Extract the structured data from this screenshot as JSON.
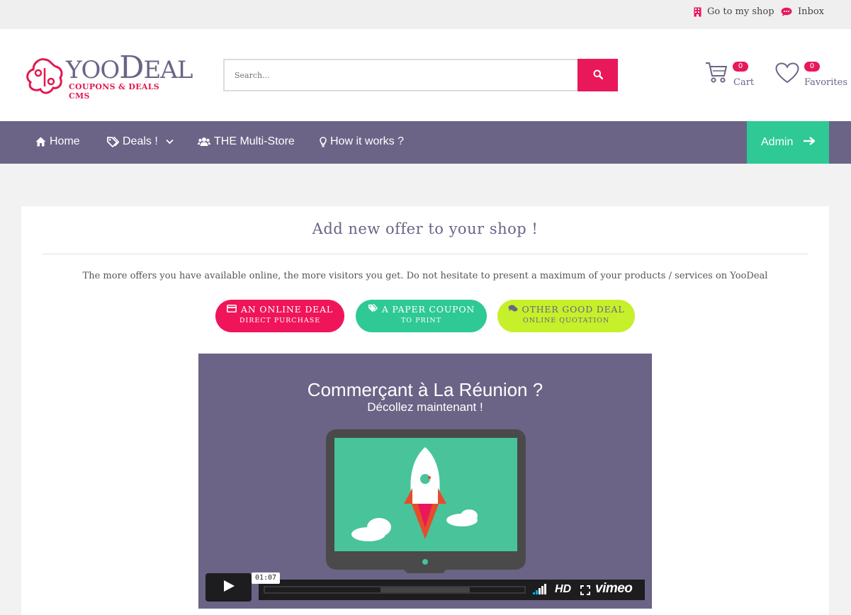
{
  "topbar": {
    "my_shop_label": "Go to my shop",
    "inbox_label": "Inbox",
    "icons": [
      "shop-icon",
      "chat-icon"
    ],
    "accent_color": "#e8185a"
  },
  "header": {
    "logo_word_prefix": "YOO",
    "logo_word_big": "D",
    "logo_word_suffix": "EAL",
    "logo_subtitle": "COUPONS & DEALS CMS",
    "search_placeholder": "Search...",
    "cart_count": "0",
    "cart_label": "Cart",
    "favorites_count": "0",
    "favorites_label": "Favorites"
  },
  "nav": {
    "items": [
      {
        "label": "Home",
        "icon": "home-icon"
      },
      {
        "label": "Deals !",
        "icon": "tags-icon"
      },
      {
        "label": "THE Multi-Store",
        "icon": "users-icon"
      },
      {
        "label": "How it works ?",
        "icon": "lightbulb-icon"
      }
    ],
    "admin_label": "Admin",
    "bg_color": "#6b6486",
    "admin_color": "#2ec995"
  },
  "main": {
    "title": "Add new offer to your shop !",
    "description": "The more offers you have available online, the more visitors you get. Do not hesitate to present a maximum of your products / services on YooDeal",
    "buttons": [
      {
        "line1": "AN ONLINE DEAL",
        "line2": "DIRECT PURCHASE",
        "color": "#f0145a",
        "icon": "credit-card-icon"
      },
      {
        "line1": "A PAPER COUPON",
        "line2": "TO PRINT",
        "color": "#2ec995",
        "icon": "tags-icon"
      },
      {
        "line1": "OTHER GOOD DEAL",
        "line2": "ONLINE QUOTATION",
        "color": "#c6f02a",
        "icon": "comments-icon"
      }
    ]
  },
  "video": {
    "title": "Commerçant à La Réunion ?",
    "subtitle": "Décollez maintenant !",
    "time": "01:07",
    "hd_label": "HD",
    "brand": "vimeo"
  }
}
